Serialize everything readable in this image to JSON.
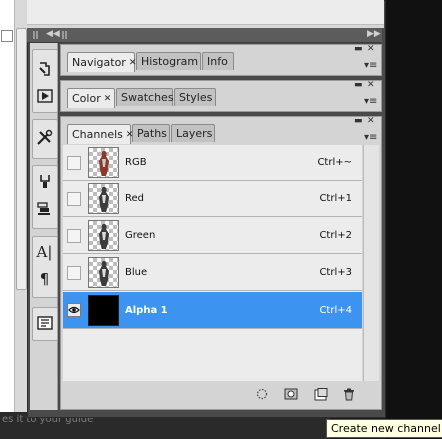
{
  "tool_column": {
    "icons": [
      "history-brush-icon",
      "play-action-icon",
      "tools-icon",
      "clone-source-icon",
      "layer-comps-icon",
      "character-icon",
      "paragraph-icon",
      "notes-icon"
    ]
  },
  "panels": {
    "navigator_group": {
      "tabs": [
        {
          "label": "Navigator",
          "close": "✕",
          "active": true
        },
        {
          "label": "Histogram",
          "active": false
        },
        {
          "label": "Info",
          "active": false
        }
      ]
    },
    "color_group": {
      "tabs": [
        {
          "label": "Color",
          "close": "✕",
          "active": true
        },
        {
          "label": "Swatches",
          "active": false
        },
        {
          "label": "Styles",
          "active": false
        }
      ]
    },
    "channels_group": {
      "tabs": [
        {
          "label": "Channels",
          "close": "✕",
          "active": true
        },
        {
          "label": "Paths",
          "active": false
        },
        {
          "label": "Layers",
          "active": false
        }
      ]
    }
  },
  "channels": [
    {
      "name": "RGB",
      "shortcut": "Ctrl+~",
      "visible": false,
      "selected": false,
      "thumb_color": "#8a3a2c"
    },
    {
      "name": "Red",
      "shortcut": "Ctrl+1",
      "visible": false,
      "selected": false,
      "thumb_color": "#3c3c3c"
    },
    {
      "name": "Green",
      "shortcut": "Ctrl+2",
      "visible": false,
      "selected": false,
      "thumb_color": "#3c3c3c"
    },
    {
      "name": "Blue",
      "shortcut": "Ctrl+3",
      "visible": false,
      "selected": false,
      "thumb_color": "#3c3c3c"
    },
    {
      "name": "Alpha 1",
      "shortcut": "Ctrl+4",
      "visible": true,
      "selected": true,
      "thumb_color": "#000000"
    }
  ],
  "eye_glyph": "👁",
  "bottom_buttons": [
    "load-selection-icon",
    "save-selection-icon",
    "new-channel-icon",
    "delete-icon"
  ],
  "tooltip": "Create new channel",
  "doc_text": "es it to your guide",
  "colors": {
    "selection": "#3d94f0"
  }
}
